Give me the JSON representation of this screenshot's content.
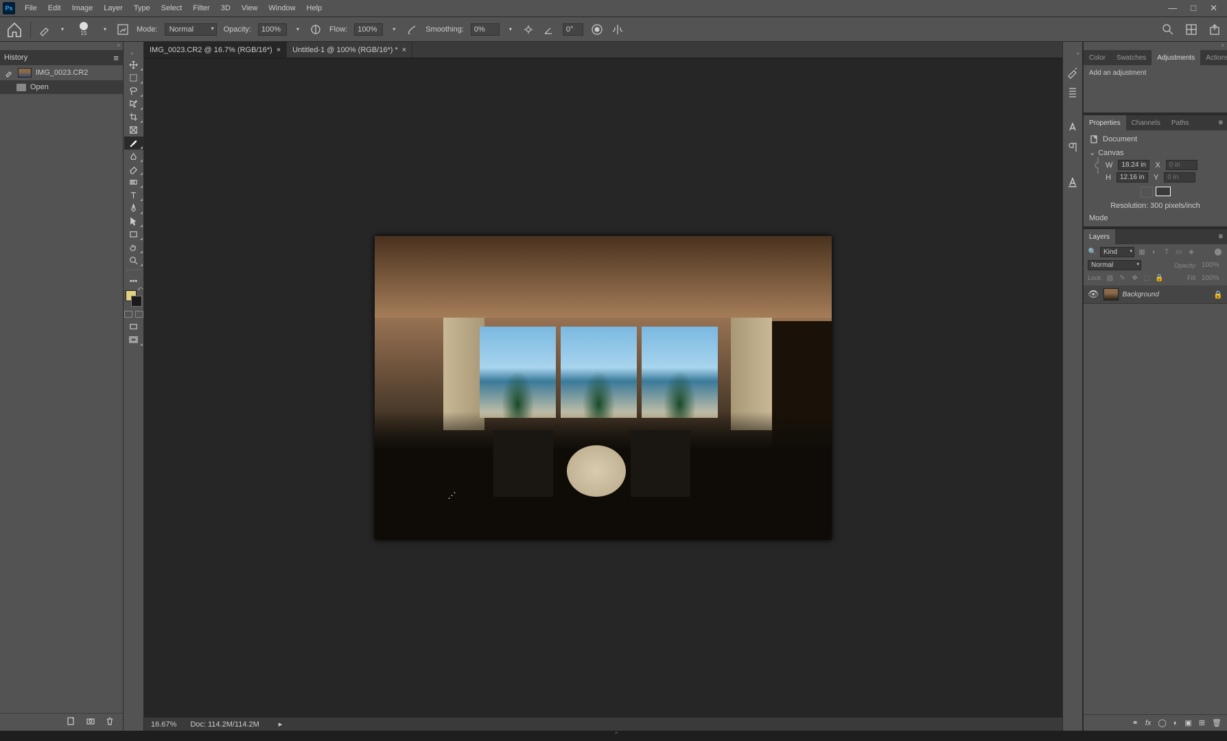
{
  "menu": [
    "File",
    "Edit",
    "Image",
    "Layer",
    "Type",
    "Select",
    "Filter",
    "3D",
    "View",
    "Window",
    "Help"
  ],
  "options": {
    "mode_lbl": "Mode:",
    "mode_val": "Normal",
    "opacity_lbl": "Opacity:",
    "opacity_val": "100%",
    "flow_lbl": "Flow:",
    "flow_val": "100%",
    "smoothing_lbl": "Smoothing:",
    "smoothing_val": "0%",
    "angle_val": "0°",
    "brush_size": "15"
  },
  "history": {
    "title": "History",
    "file": "IMG_0023.CR2",
    "step": "Open"
  },
  "tabs": {
    "t1": "IMG_0023.CR2 @ 16.7% (RGB/16*)",
    "t2": "Untitled-1 @ 100% (RGB/16*) *"
  },
  "status": {
    "zoom": "16.67%",
    "doc": "Doc: 114.2M/114.2M"
  },
  "right_tabs": {
    "color": "Color",
    "swatches": "Swatches",
    "adjustments": "Adjustments",
    "actions": "Actions",
    "properties": "Properties",
    "channels": "Channels",
    "paths": "Paths",
    "layers": "Layers"
  },
  "adjustments": {
    "label": "Add an adjustment"
  },
  "properties": {
    "doc": "Document",
    "canvas": "Canvas",
    "w_lbl": "W",
    "w_val": "18.24 in",
    "h_lbl": "H",
    "h_val": "12.16 in",
    "x_lbl": "X",
    "x_val": "0 in",
    "y_lbl": "Y",
    "y_val": "0 in",
    "res_lbl": "Resolution:",
    "res_val": "300 pixels/inch",
    "mode_lbl": "Mode"
  },
  "layers": {
    "kind_lbl": "Kind",
    "blend": "Normal",
    "opacity_lbl": "Opacity:",
    "opacity_val": "100%",
    "lock_lbl": "Lock:",
    "fill_lbl": "Fill:",
    "fill_val": "100%",
    "bg": "Background",
    "filter_search": "🔍"
  }
}
